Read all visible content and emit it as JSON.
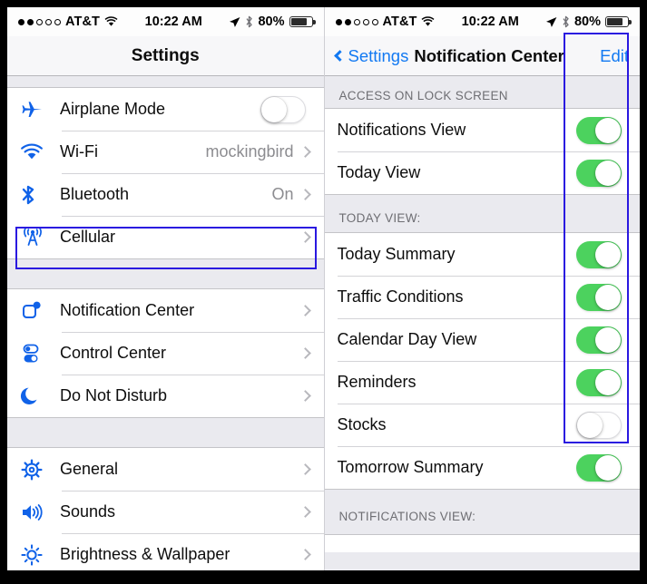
{
  "status_bar": {
    "signal_dots_filled": 2,
    "signal_dots_total": 5,
    "carrier": "AT&T",
    "wifi_icon": "wifi-icon",
    "time": "10:22 AM",
    "location_icon": "location-arrow-icon",
    "bluetooth_icon": "bluetooth-icon",
    "battery_percent": "80%",
    "battery_level": 80
  },
  "left_pane": {
    "nav": {
      "title": "Settings"
    },
    "groups": [
      {
        "rows": [
          {
            "icon": "airplane-icon",
            "label": "Airplane Mode",
            "accessory": "toggle",
            "toggle_on": false
          },
          {
            "icon": "wifi-icon",
            "label": "Wi-Fi",
            "accessory": "chevron",
            "value": "mockingbird"
          },
          {
            "icon": "bluetooth-icon",
            "label": "Bluetooth",
            "accessory": "chevron",
            "value": "On"
          },
          {
            "icon": "cellular-tower-icon",
            "label": "Cellular",
            "accessory": "chevron",
            "value": ""
          }
        ]
      },
      {
        "rows": [
          {
            "icon": "notification-center-icon",
            "label": "Notification Center",
            "accessory": "chevron",
            "value": "",
            "highlighted": true
          },
          {
            "icon": "control-center-icon",
            "label": "Control Center",
            "accessory": "chevron",
            "value": ""
          },
          {
            "icon": "moon-icon",
            "label": "Do Not Disturb",
            "accessory": "chevron",
            "value": ""
          }
        ]
      },
      {
        "rows": [
          {
            "icon": "gear-icon",
            "label": "General",
            "accessory": "chevron",
            "value": ""
          },
          {
            "icon": "speaker-icon",
            "label": "Sounds",
            "accessory": "chevron",
            "value": ""
          },
          {
            "icon": "brightness-icon",
            "label": "Brightness & Wallpaper",
            "accessory": "chevron",
            "value": ""
          }
        ]
      }
    ]
  },
  "right_pane": {
    "nav": {
      "back_label": "Settings",
      "back_icon": "chevron-left-icon",
      "title": "Notification Center",
      "edit_label": "Edit"
    },
    "sections": [
      {
        "header": "ACCESS ON LOCK SCREEN",
        "rows": [
          {
            "label": "Notifications View",
            "toggle_on": true
          },
          {
            "label": "Today View",
            "toggle_on": true
          }
        ]
      },
      {
        "header": "TODAY VIEW:",
        "rows": [
          {
            "label": "Today Summary",
            "toggle_on": true
          },
          {
            "label": "Traffic Conditions",
            "toggle_on": true
          },
          {
            "label": "Calendar Day View",
            "toggle_on": true
          },
          {
            "label": "Reminders",
            "toggle_on": true
          },
          {
            "label": "Stocks",
            "toggle_on": false
          },
          {
            "label": "Tomorrow Summary",
            "toggle_on": true
          }
        ]
      },
      {
        "header": "NOTIFICATIONS VIEW:",
        "rows": []
      }
    ]
  },
  "annotations": {
    "highlight_color": "#2a18e0",
    "boxes": [
      {
        "name": "notification-center-row-highlight"
      },
      {
        "name": "toggle-column-highlight"
      }
    ]
  },
  "colors": {
    "toggle_on": "#4CD25E",
    "tint_blue": "#1279f2",
    "icon_blue": "#1062e8",
    "group_bg": "#eaeaef",
    "separator": "#d3d3d7"
  }
}
